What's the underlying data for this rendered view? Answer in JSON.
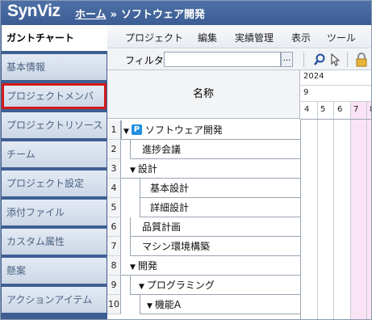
{
  "header": {
    "logo": "SynViz",
    "home_link": "ホーム",
    "separator": "»",
    "current": "ソフトウェア開発"
  },
  "sidebar": {
    "items": [
      {
        "label": "ガントチャート"
      },
      {
        "label": "基本情報"
      },
      {
        "label": "プロジェクトメンバ"
      },
      {
        "label": "プロジェクトリソース"
      },
      {
        "label": "チーム"
      },
      {
        "label": "プロジェクト設定"
      },
      {
        "label": "添付ファイル"
      },
      {
        "label": "カスタム属性"
      },
      {
        "label": "懸案"
      },
      {
        "label": "アクションアイテム"
      }
    ]
  },
  "menu": {
    "items": [
      "プロジェクト",
      "編集",
      "実績管理",
      "表示",
      "ツール"
    ]
  },
  "toolbar": {
    "filter_label": "フィルタ",
    "filter_value": "",
    "browse_label": "..."
  },
  "grid": {
    "name_header": "名称",
    "year": "2024",
    "month": "9",
    "days": [
      "4",
      "5",
      "6",
      "7",
      "8"
    ],
    "rows": [
      {
        "num": "1",
        "name": "ソフトウェア開発",
        "tri": "▼",
        "icon": "P"
      },
      {
        "num": "2",
        "name": "進捗会議",
        "tri": "",
        "icon": ""
      },
      {
        "num": "3",
        "name": "設計",
        "tri": "▼",
        "icon": ""
      },
      {
        "num": "4",
        "name": "基本設計",
        "tri": "",
        "icon": ""
      },
      {
        "num": "5",
        "name": "詳細設計",
        "tri": "",
        "icon": ""
      },
      {
        "num": "6",
        "name": "品質計画",
        "tri": "",
        "icon": ""
      },
      {
        "num": "7",
        "name": "マシン環境構築",
        "tri": "",
        "icon": ""
      },
      {
        "num": "8",
        "name": "開発",
        "tri": "▼",
        "icon": ""
      },
      {
        "num": "9",
        "name": "プログラミング",
        "tri": "▼",
        "icon": ""
      },
      {
        "num": "10",
        "name": "機能A",
        "tri": "▼",
        "icon": ""
      }
    ]
  },
  "colors": {
    "header_bg": "#3c5d94",
    "highlight_border": "#d11a1a",
    "weekend_col": "#f9e3f4",
    "project_icon": "#1f8fe0"
  }
}
